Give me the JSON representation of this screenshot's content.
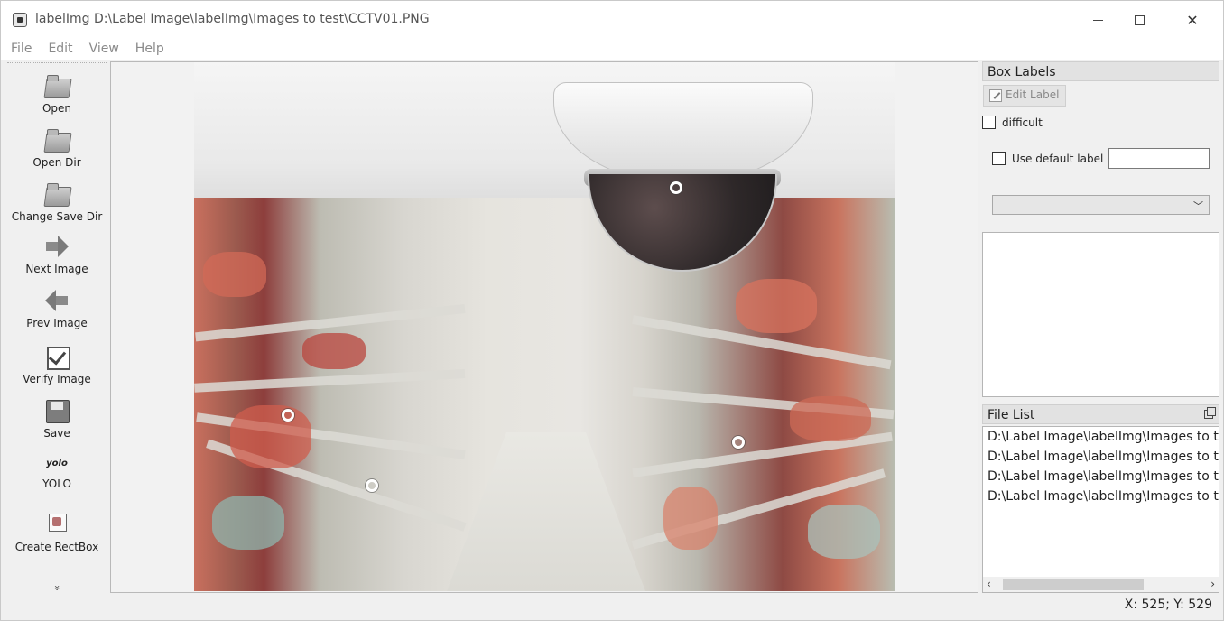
{
  "window": {
    "title": "labelImg D:\\Label Image\\labelImg\\Images to test\\CCTV01.PNG",
    "controls": [
      "minimize",
      "maximize",
      "close"
    ]
  },
  "menu": {
    "items": [
      "File",
      "Edit",
      "View",
      "Help"
    ]
  },
  "toolbar": {
    "items": [
      {
        "label": "Open",
        "icon": "folder-icon"
      },
      {
        "label": "Open Dir",
        "icon": "folder-icon"
      },
      {
        "label": "Change Save Dir",
        "icon": "folder-icon"
      },
      {
        "label": "Next Image",
        "icon": "arrow-right-icon"
      },
      {
        "label": "Prev Image",
        "icon": "arrow-left-icon"
      },
      {
        "label": "Verify Image",
        "icon": "checkbox-icon"
      },
      {
        "label": "Save",
        "icon": "floppy-icon"
      },
      {
        "label": "YOLO",
        "icon": "yolo-icon",
        "icon_text": "yolo"
      },
      {
        "label": "Create RectBox",
        "icon": "rectbox-icon"
      }
    ],
    "more_glyph": "»"
  },
  "canvas": {
    "image_file": "CCTV01.PNG",
    "vertex_color": "#ffffff"
  },
  "box_labels": {
    "title": "Box Labels",
    "edit_label": "Edit Label",
    "difficult": {
      "label": "difficult",
      "checked": false
    },
    "use_default": {
      "label": "Use default label",
      "checked": false,
      "value": ""
    },
    "combo_value": "",
    "labels": []
  },
  "file_list": {
    "title": "File List",
    "files": [
      "D:\\Label Image\\labelImg\\Images to te",
      "D:\\Label Image\\labelImg\\Images to te",
      "D:\\Label Image\\labelImg\\Images to te",
      "D:\\Label Image\\labelImg\\Images to te"
    ]
  },
  "status": {
    "coords": "X: 525; Y: 529"
  },
  "colors": {
    "window_bg": "#f0f0f0",
    "dock_title_bg": "#e2e2e2",
    "menu_text": "#8a8a8a"
  }
}
